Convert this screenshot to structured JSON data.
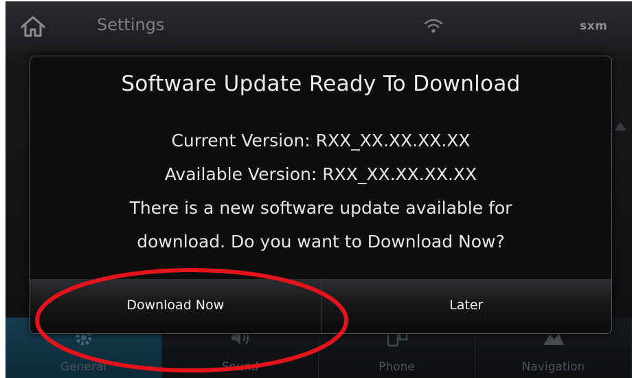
{
  "header": {
    "home_icon": "home-icon",
    "title": "Settings",
    "wifi_icon": "wifi-icon",
    "sxm_logo": "sxm"
  },
  "dialog": {
    "title": "Software Update Ready To Download",
    "current_version": "Current Version: RXX_XX.XX.XX.XX",
    "available_version": "Available Version: RXX_XX.XX.XX.XX",
    "message_line1": "There is a new software update available for",
    "message_line2": "download. Do you want to Download Now?",
    "buttons": {
      "download_now": "Download Now",
      "later": "Later"
    }
  },
  "bottom_nav": {
    "tabs": [
      {
        "label": "General",
        "icon": "gear-icon",
        "active": true
      },
      {
        "label": "Sound",
        "icon": "speaker-icon",
        "active": false
      },
      {
        "label": "Phone",
        "icon": "phone-icon",
        "active": false
      },
      {
        "label": "Navigation",
        "icon": "map-icon",
        "active": false
      }
    ]
  },
  "colors": {
    "annotation": "#e4141c",
    "active_tab": "#153d4f",
    "dialog_bg": "#0e0e0f"
  }
}
